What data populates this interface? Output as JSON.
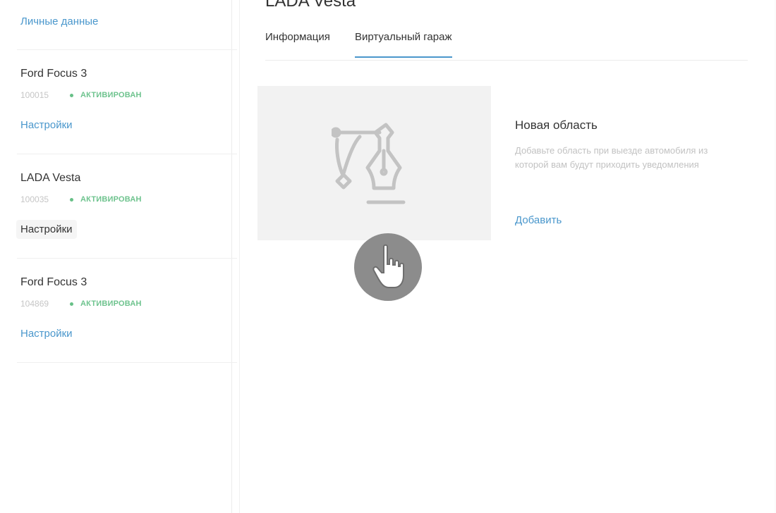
{
  "sidebar": {
    "personal_link": "Личные данные",
    "cars": [
      {
        "name": "Ford Focus 3",
        "id": "100015",
        "status": "АКТИВИРОВАН",
        "settings": "Настройки"
      },
      {
        "name": "LADA Vesta",
        "id": "100035",
        "status": "АКТИВИРОВАН",
        "settings": "Настройки"
      },
      {
        "name": "Ford Focus 3",
        "id": "104869",
        "status": "АКТИВИРОВАН",
        "settings": "Настройки"
      }
    ]
  },
  "main": {
    "title": "LADA Vesta",
    "tabs": [
      {
        "label": "Информация",
        "active": false
      },
      {
        "label": "Виртуальный гараж",
        "active": true
      }
    ],
    "zone": {
      "title": "Новая область",
      "description": "Добавьте область при выезде автомобиля из которой вам будут приходить уведомления",
      "add_label": "Добавить",
      "image_icon": "pen-tool-icon"
    }
  },
  "cursor_icon": "hand-pointer-icon",
  "colors": {
    "accent": "#4a97cc",
    "status_active": "#6ec38e",
    "placeholder_bg": "#f2f2f2"
  }
}
